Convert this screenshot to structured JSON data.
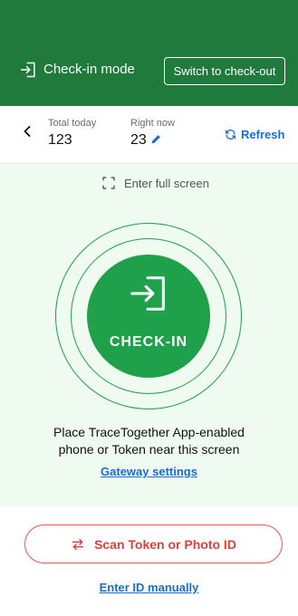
{
  "header": {
    "mode_label": "Check-in mode",
    "switch_label": "Switch to check-out",
    "background": "#1f7a3c"
  },
  "stats": {
    "total_caption": "Total today",
    "total_value": "123",
    "now_caption": "Right now",
    "now_value": "23",
    "refresh_label": "Refresh"
  },
  "main": {
    "fullscreen_label": "Enter full screen",
    "checkin_label": "CHECK-IN",
    "instruction": "Place TraceTogether App-enabled phone or Token near this screen",
    "gateway_label": "Gateway settings",
    "background": "#effaf1",
    "accent": "#1fa04a"
  },
  "footer": {
    "scan_label": "Scan Token or Photo ID",
    "manual_label": "Enter ID manually",
    "scan_color": "#e23d3d"
  },
  "icons": {
    "mode": "check-in-icon",
    "back": "chevron-left-icon",
    "edit": "pencil-icon",
    "refresh": "refresh-icon",
    "fullscreen": "fullscreen-icon",
    "checkin": "door-enter-icon",
    "scan": "swap-arrows-icon"
  }
}
